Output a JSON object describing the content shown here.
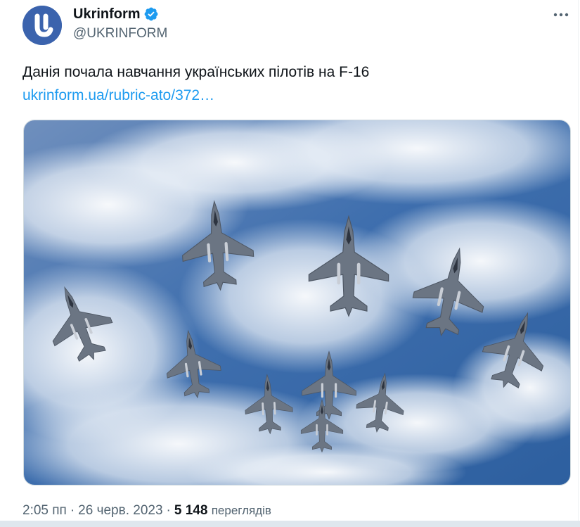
{
  "author": {
    "display_name": "Ukrinform",
    "handle": "@UKRINFORM",
    "avatar_letter": "U",
    "verified": true,
    "avatar_color": "#3b63ad"
  },
  "actions": {
    "more_icon": "more-horizontal-icon"
  },
  "tweet": {
    "text": "Данія почала навчання українських пілотів на F-16",
    "link_text": "ukrinform.ua/rubric-ato/372…",
    "link_color": "#1d9bf0"
  },
  "media": {
    "type": "photo",
    "subject": "formation of F-16 fighter jets against a blue sky with white clouds"
  },
  "meta": {
    "time": "2:05 пп",
    "separator": "·",
    "date": "26 черв. 2023",
    "views_count": "5 148",
    "views_label": "переглядів"
  },
  "colors": {
    "text_primary": "#0f1419",
    "text_secondary": "#536471",
    "verified_badge": "#1d9bf0"
  }
}
